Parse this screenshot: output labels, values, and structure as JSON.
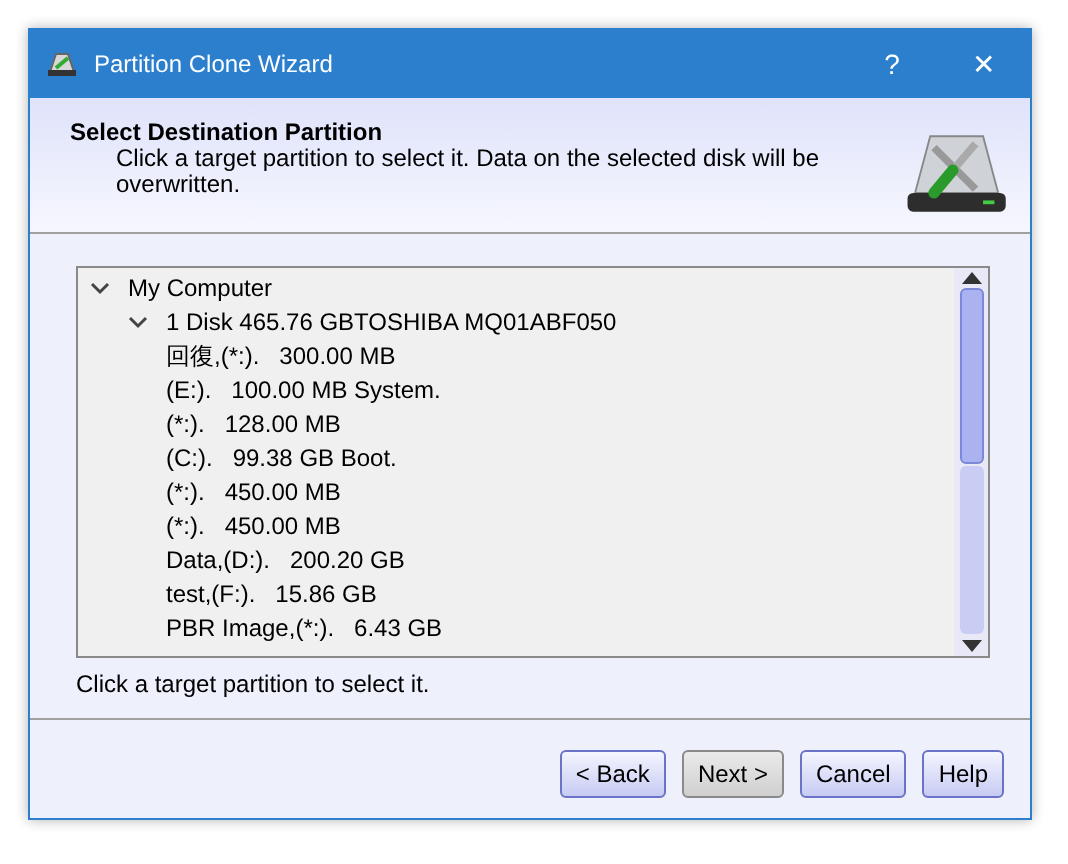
{
  "window": {
    "title": "Partition Clone Wizard",
    "controls": [
      "?",
      "✕"
    ]
  },
  "header": {
    "title": "Select Destination Partition",
    "description": "Click a target partition to select it. Data on the selected disk will be overwritten."
  },
  "tree": [
    {
      "label": "My Computer",
      "expanded": true,
      "children": [
        {
          "label": "1 Disk 465.76 GBTOSHIBA MQ01ABF050",
          "expanded": true,
          "children": [
            {
              "label": "回復,(*:).   300.00 MB"
            },
            {
              "label": "(E:).   100.00 MB System."
            },
            {
              "label": "(*:).   128.00 MB"
            },
            {
              "label": "(C:).   99.38 GB Boot."
            },
            {
              "label": "(*:).   450.00 MB"
            },
            {
              "label": "(*:).   450.00 MB"
            },
            {
              "label": "Data,(D:).   200.20 GB"
            },
            {
              "label": "test,(F:).   15.86 GB"
            },
            {
              "label": "PBR Image,(*:).   6.43 GB"
            }
          ]
        }
      ]
    }
  ],
  "status": "Click a target partition to select it.",
  "buttons": [
    {
      "label": "< Back",
      "focused": false
    },
    {
      "label": "Next >",
      "focused": true
    },
    {
      "label": "Cancel",
      "focused": false
    },
    {
      "label": "Help",
      "focused": false
    }
  ]
}
